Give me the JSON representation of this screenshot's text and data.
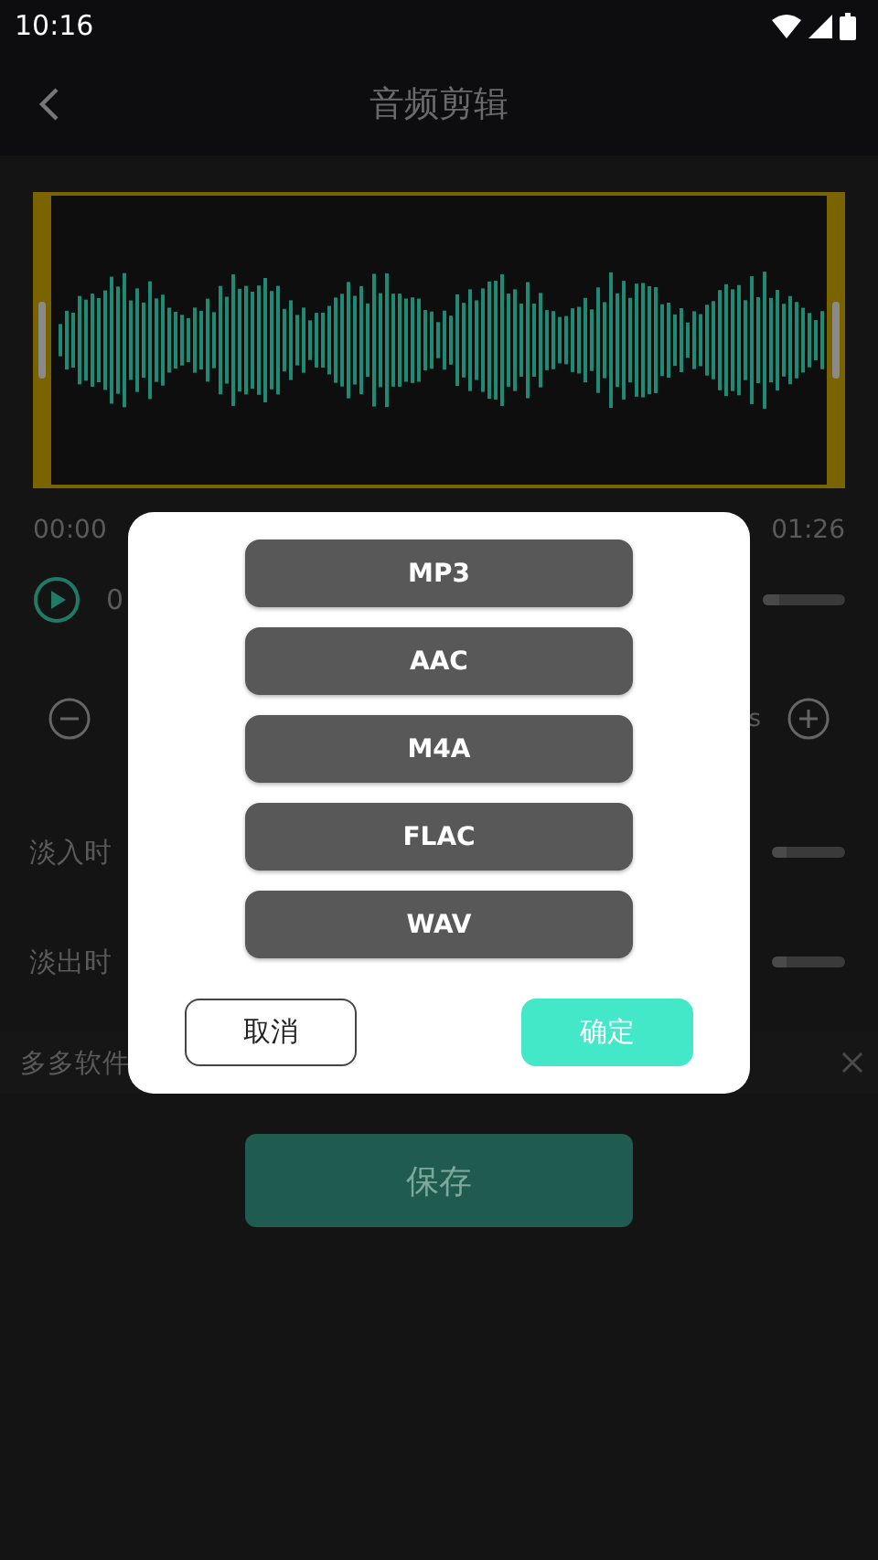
{
  "status_bar": {
    "time": "10:16"
  },
  "header": {
    "title": "音频剪辑"
  },
  "editor": {
    "start_time": "00:00",
    "end_time": "01:26",
    "position_text": "0",
    "step_unit": "s",
    "fade_in_label": "淡入时",
    "fade_out_label": "淡出时",
    "playback_slider": {
      "level": 0.2
    },
    "fade_in_slider": {
      "level": 0.2
    },
    "fade_out_slider": {
      "level": 0.2
    }
  },
  "ad_bar": {
    "text": "多多软件"
  },
  "save_button": "保存",
  "dialog": {
    "formats": [
      {
        "label": "MP3"
      },
      {
        "label": "AAC"
      },
      {
        "label": "M4A"
      },
      {
        "label": "FLAC"
      },
      {
        "label": "WAV"
      }
    ],
    "cancel": "取消",
    "confirm": "确定"
  }
}
